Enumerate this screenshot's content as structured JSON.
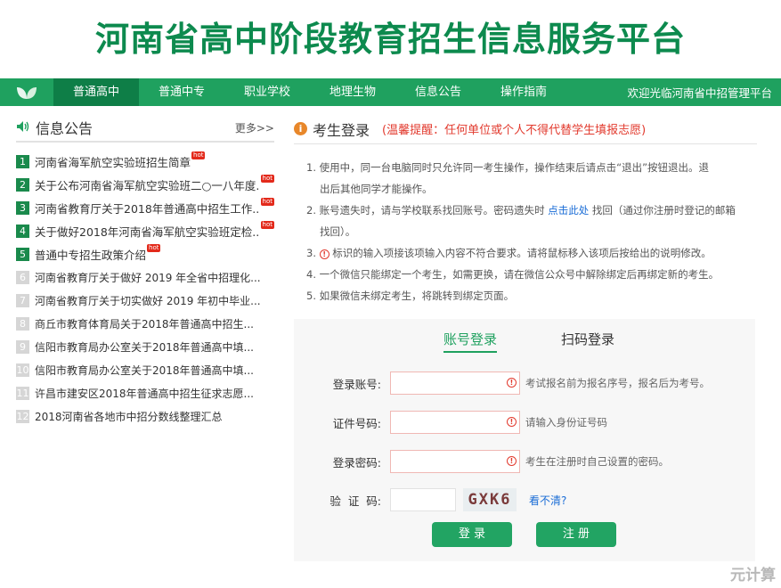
{
  "site": {
    "title": "河南省高中阶段教育招生信息服务平台"
  },
  "nav": {
    "items": [
      "普通高中",
      "普通中专",
      "职业学校",
      "地理生物",
      "信息公告",
      "操作指南"
    ],
    "welcome": "欢迎光临河南省中招管理平台"
  },
  "news": {
    "title": "信息公告",
    "more": "更多>>",
    "hot_badge": "hot",
    "items": [
      {
        "num": "1",
        "text": "河南省海军航空实验班招生简章",
        "hot": true
      },
      {
        "num": "2",
        "text": "关于公布河南省海军航空实验班二○一八年度...",
        "hot": true
      },
      {
        "num": "3",
        "text": "河南省教育厅关于2018年普通高中招生工作...",
        "hot": true
      },
      {
        "num": "4",
        "text": "关于做好2018年河南省海军航空实验班定检...",
        "hot": true
      },
      {
        "num": "5",
        "text": "普通中专招生政策介绍",
        "hot": true
      },
      {
        "num": "6",
        "text": "河南省教育厅关于做好 2019 年全省中招理化...",
        "hot": false
      },
      {
        "num": "7",
        "text": "河南省教育厅关于切实做好 2019 年初中毕业...",
        "hot": false
      },
      {
        "num": "8",
        "text": "商丘市教育体育局关于2018年普通高中招生...",
        "hot": false
      },
      {
        "num": "9",
        "text": "信阳市教育局办公室关于2018年普通高中填...",
        "hot": false
      },
      {
        "num": "10",
        "text": "信阳市教育局办公室关于2018年普通高中填...",
        "hot": false
      },
      {
        "num": "11",
        "text": "许昌市建安区2018年普通高中招生征求志愿...",
        "hot": false
      },
      {
        "num": "12",
        "text": "2018河南省各地市中招分数线整理汇总",
        "hot": false
      }
    ]
  },
  "login": {
    "title": "考生登录",
    "tip": "(温馨提醒：任何单位或个人不得代替学生填报志愿)",
    "rules": {
      "r1a": "1. 使用中，同一台电脑同时只允许同一考生操作，操作结束后请点击“退出”按钮退出。退",
      "r1b": "出后其他同学才能操作。",
      "r2a_pre": "2. 账号遗失时，请与学校联系找回账号。密码遗失时 ",
      "r2a_link": "点击此处",
      "r2a_post": " 找回（通过你注册时登记的邮箱",
      "r2b": "找回）。",
      "r3_pre": "3. ",
      "r3_post": " 标识的输入项接该项输入内容不符合要求。请将鼠标移入该项后按给出的说明修改。",
      "r4": "4. 一个微信只能绑定一个考生，如需更换，请在微信公众号中解除绑定后再绑定新的考生。",
      "r5": "5. 如果微信未绑定考生，将跳转到绑定页面。"
    },
    "tabs": {
      "account": "账号登录",
      "qrcode": "扫码登录"
    },
    "fields": {
      "account_label": "登录账号:",
      "account_hint": "考试报名前为报名序号，报名后为考号。",
      "id_label": "证件号码:",
      "id_hint": "请输入身份证号码",
      "password_label": "登录密码:",
      "password_hint": "考生在注册时自己设置的密码。",
      "captcha_label": "验  证  码:",
      "captcha_text": "GXK6",
      "captcha_refresh": "看不清?"
    },
    "buttons": {
      "login": "登 录",
      "register": "注 册"
    }
  },
  "watermark": "元计算",
  "colors": {
    "brand_green": "#1fa15f",
    "dark_green": "#0d8a4e",
    "warn_red": "#e23a2e",
    "link_blue": "#1b6dd6"
  }
}
